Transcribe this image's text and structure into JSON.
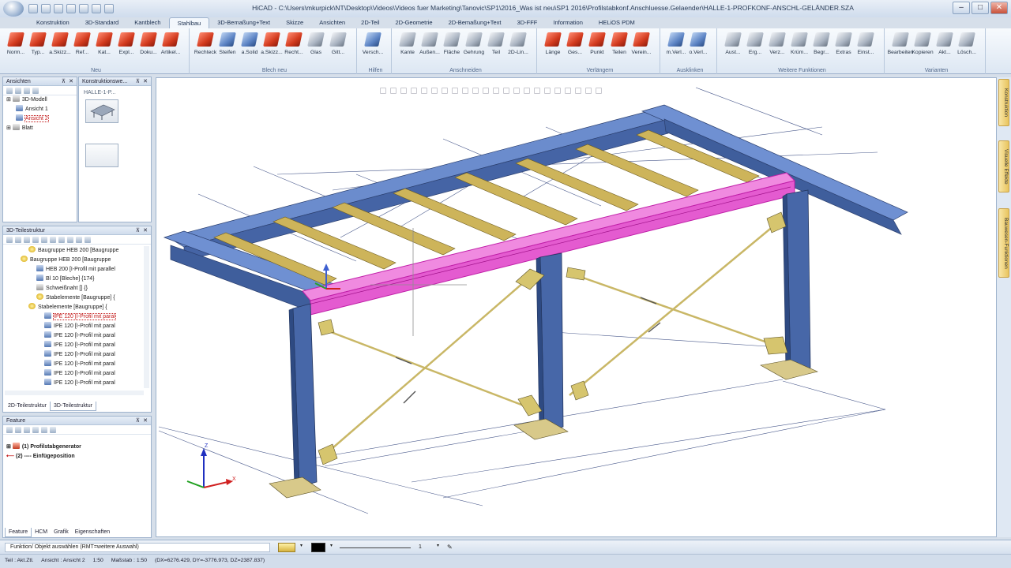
{
  "window": {
    "title": "HiCAD - C:\\Users\\mkurpick\\NT\\Desktop\\Videos\\Videos fuer Marketing\\Tanovic\\SP1\\2016_Was ist neu\\SP1 2016\\Profilstabkonf.Anschluesse.Gelaender\\HALLE-1-PROFKONF-ANSCHL-GELÄNDER.SZA",
    "controls": [
      "–",
      "□",
      "✕"
    ]
  },
  "ribbon_tabs": [
    {
      "label": "Konstruktion",
      "active": false
    },
    {
      "label": "3D-Standard",
      "active": false
    },
    {
      "label": "Kantblech",
      "active": false
    },
    {
      "label": "Stahlbau",
      "active": true
    },
    {
      "label": "3D-Bemaßung+Text",
      "active": false
    },
    {
      "label": "Skizze",
      "active": false
    },
    {
      "label": "Ansichten",
      "active": false
    },
    {
      "label": "2D-Teil",
      "active": false
    },
    {
      "label": "2D-Geometrie",
      "active": false
    },
    {
      "label": "2D-Bemaßung+Text",
      "active": false
    },
    {
      "label": "3D-FFF",
      "active": false
    },
    {
      "label": "Information",
      "active": false
    },
    {
      "label": "HELiOS PDM",
      "active": false
    }
  ],
  "ribbon_groups": [
    {
      "name": "Neu",
      "buttons": [
        {
          "label": "Norm...",
          "icon": "beam-icon",
          "color": "red"
        },
        {
          "label": "Typ...",
          "icon": "profile-type-icon",
          "color": "red"
        },
        {
          "label": "a.Skizz...",
          "icon": "sketch-beam-icon",
          "color": "red"
        },
        {
          "label": "Ref...",
          "icon": "reference-icon",
          "color": "red"
        },
        {
          "label": "Kat...",
          "icon": "catalog-icon",
          "color": "red"
        },
        {
          "label": "Expl...",
          "icon": "explorer-icon",
          "color": "red"
        },
        {
          "label": "Doku...",
          "icon": "document-icon",
          "color": "red"
        },
        {
          "label": "Artikel...",
          "icon": "article-icon",
          "color": "red"
        }
      ]
    },
    {
      "name": "Blech neu",
      "buttons": [
        {
          "label": "Rechteck",
          "icon": "rectangle-plate-icon",
          "color": "red"
        },
        {
          "label": "Steifen",
          "icon": "stiffener-icon",
          "color": "blue"
        },
        {
          "label": "a.Solid",
          "icon": "from-solid-icon",
          "color": "blue"
        },
        {
          "label": "a.Skizz...",
          "icon": "plate-sketch-icon",
          "color": "red"
        },
        {
          "label": "Recht...",
          "icon": "plate-rect-icon",
          "color": "red"
        },
        {
          "label": "Glas",
          "icon": "glass-icon",
          "color": "gray"
        },
        {
          "label": "Gitt...",
          "icon": "grating-icon",
          "color": "gray"
        }
      ]
    },
    {
      "name": "Hilfen",
      "buttons": [
        {
          "label": "Versch...",
          "icon": "shift-icon",
          "color": "blue"
        }
      ]
    },
    {
      "name": "Anschneiden",
      "buttons": [
        {
          "label": "Kante",
          "icon": "edge-cut-icon",
          "color": "gray"
        },
        {
          "label": "Außen...",
          "icon": "outer-cut-icon",
          "color": "gray"
        },
        {
          "label": "Fläche",
          "icon": "face-cut-icon",
          "color": "gray"
        },
        {
          "label": "Gehrung",
          "icon": "miter-icon",
          "color": "gray"
        },
        {
          "label": "Teil",
          "icon": "part-cut-icon",
          "color": "gray"
        },
        {
          "label": "2D-Lin...",
          "icon": "2d-line-cut-icon",
          "color": "gray"
        }
      ]
    },
    {
      "name": "Verlängern",
      "buttons": [
        {
          "label": "Länge",
          "icon": "length-icon",
          "color": "red"
        },
        {
          "label": "Ges...",
          "icon": "total-length-icon",
          "color": "red"
        },
        {
          "label": "Punkt",
          "icon": "point-extend-icon",
          "color": "red"
        },
        {
          "label": "Teilen",
          "icon": "split-icon",
          "color": "red"
        },
        {
          "label": "Verein...",
          "icon": "merge-icon",
          "color": "red"
        }
      ]
    },
    {
      "name": "Ausklinken",
      "buttons": [
        {
          "label": "m.Verl...",
          "icon": "notch-extend-icon",
          "color": "blue"
        },
        {
          "label": "o.Verl...",
          "icon": "notch-no-extend-icon",
          "color": "blue"
        }
      ]
    },
    {
      "name": "Weitere Funktionen",
      "buttons": [
        {
          "label": "Aust...",
          "icon": "replace-icon",
          "color": "gray"
        },
        {
          "label": "Erg...",
          "icon": "supplement-icon",
          "color": "gray"
        },
        {
          "label": "Verz...",
          "icon": "directory-icon",
          "color": "gray"
        },
        {
          "label": "Krüm...",
          "icon": "curve-icon",
          "color": "gray"
        },
        {
          "label": "Begr...",
          "icon": "limit-icon",
          "color": "gray"
        },
        {
          "label": "Extras",
          "icon": "extras-icon",
          "color": "gray"
        },
        {
          "label": "Einst...",
          "icon": "settings-icon",
          "color": "gray"
        }
      ]
    },
    {
      "name": "Varianten",
      "buttons": [
        {
          "label": "Bearbeiten",
          "icon": "edit-variant-icon",
          "color": "gray"
        },
        {
          "label": "Kopieren",
          "icon": "copy-variant-icon",
          "color": "gray"
        },
        {
          "label": "Akt...",
          "icon": "update-variant-icon",
          "color": "gray"
        },
        {
          "label": "Lösch...",
          "icon": "delete-variant-icon",
          "color": "gray"
        }
      ]
    }
  ],
  "panes": {
    "ansichten": {
      "title": "Ansichten",
      "tree": [
        {
          "label": "3D-Modell",
          "indent": 0,
          "highlight": false
        },
        {
          "label": "Ansicht 1",
          "indent": 1,
          "highlight": false
        },
        {
          "label": "Ansicht 2",
          "indent": 1,
          "highlight": true
        },
        {
          "label": "Blatt",
          "indent": 0,
          "highlight": false
        }
      ]
    },
    "konstruktion": {
      "title": "Konstruktionswe...",
      "item_label": "HALLE-1-P..."
    },
    "teilestruktur": {
      "title": "3D-Teilestruktur",
      "rows": [
        {
          "label": "Baugruppe HEB 200 [Baugruppe",
          "indent": 3,
          "icon": "yl",
          "red": false
        },
        {
          "label": "Baugruppe HEB 200 [Baugruppe",
          "indent": 2,
          "icon": "yl",
          "red": false
        },
        {
          "label": "HEB 200 [I-Profil mit parallel",
          "indent": 4,
          "icon": "bl",
          "red": false
        },
        {
          "label": "Bl 10 [Bleche] {174}",
          "indent": 4,
          "icon": "bl",
          "red": false
        },
        {
          "label": "Schweißnaht [] {}",
          "indent": 4,
          "icon": "gr",
          "red": false
        },
        {
          "label": "Stabelemente [Baugruppe] {",
          "indent": 4,
          "icon": "yl",
          "red": false
        },
        {
          "label": "Stabelemente [Baugruppe] {",
          "indent": 3,
          "icon": "yl",
          "red": false
        },
        {
          "label": "IPE 120 [I-Profil mit paral",
          "indent": 5,
          "icon": "bl",
          "red": true
        },
        {
          "label": "IPE 120 [I-Profil mit paral",
          "indent": 5,
          "icon": "bl",
          "red": false
        },
        {
          "label": "IPE 120 [I-Profil mit paral",
          "indent": 5,
          "icon": "bl",
          "red": false
        },
        {
          "label": "IPE 120 [I-Profil mit paral",
          "indent": 5,
          "icon": "bl",
          "red": false
        },
        {
          "label": "IPE 120 [I-Profil mit paral",
          "indent": 5,
          "icon": "bl",
          "red": false
        },
        {
          "label": "IPE 120 [I-Profil mit paral",
          "indent": 5,
          "icon": "bl",
          "red": false
        },
        {
          "label": "IPE 120 [I-Profil mit paral",
          "indent": 5,
          "icon": "bl",
          "red": false
        },
        {
          "label": "IPE 120 [I-Profil mit paral",
          "indent": 5,
          "icon": "bl",
          "red": false
        }
      ],
      "tabs": [
        "2D-Teilestruktur",
        "3D-Teilestruktur"
      ],
      "active_tab": 1
    },
    "feature": {
      "title": "Feature",
      "rows": [
        {
          "label": "(1) Profilstabgenerator",
          "icon": "rd"
        },
        {
          "label": "(2) ---- Einfügeposition",
          "icon": "arrow"
        }
      ],
      "tabs": [
        "Feature",
        "HCM",
        "Grafik",
        "Eigenschaften"
      ],
      "active_tab": 0
    }
  },
  "side_tabs": [
    "Konstruktion",
    "Visuelle Effekte",
    "Bauwesen-Funktionen"
  ],
  "command": {
    "prompt": "Funktion/ Objekt auswählen (RMT=weitere Auswahl)",
    "line_width": "1"
  },
  "status": {
    "part": "Teil : Akt.Ztl.",
    "view": "Ansicht : Ansicht 2",
    "scale": "1:50",
    "scale_label": "Maßstab : 1:50",
    "coords": "(DX=6276.429, DY=-3776.973, DZ=2387.837)"
  },
  "axis_labels": {
    "z": "Z",
    "x": "X"
  },
  "colors": {
    "frame_blue": "#4f74b8",
    "beam_yellow": "#cdb45a",
    "selection_magenta": "#e040c8",
    "brace": "#c9b766"
  }
}
